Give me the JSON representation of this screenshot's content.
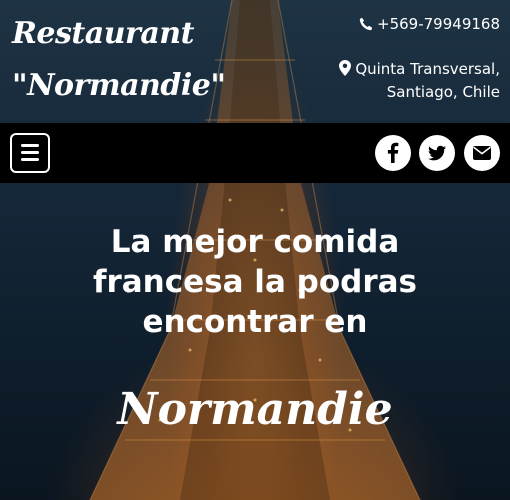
{
  "header": {
    "brand_line1": "Restaurant",
    "brand_line2": "\"Normandie\"",
    "phone": "+569-79949168",
    "address_line1": "Quinta Transversal,",
    "address_line2": "Santiago, Chile"
  },
  "navbar": {
    "menu_icon": "hamburger-icon",
    "social": [
      {
        "name": "facebook-icon"
      },
      {
        "name": "twitter-icon"
      },
      {
        "name": "envelope-icon"
      }
    ]
  },
  "hero": {
    "tagline_line1": "La mejor comida",
    "tagline_line2": "francesa la podras",
    "tagline_line3": "encontrar en",
    "name": "Normandie"
  },
  "colors": {
    "text": "#ffffff",
    "navbar_bg": "#000000",
    "glow": "#e28c3c"
  }
}
